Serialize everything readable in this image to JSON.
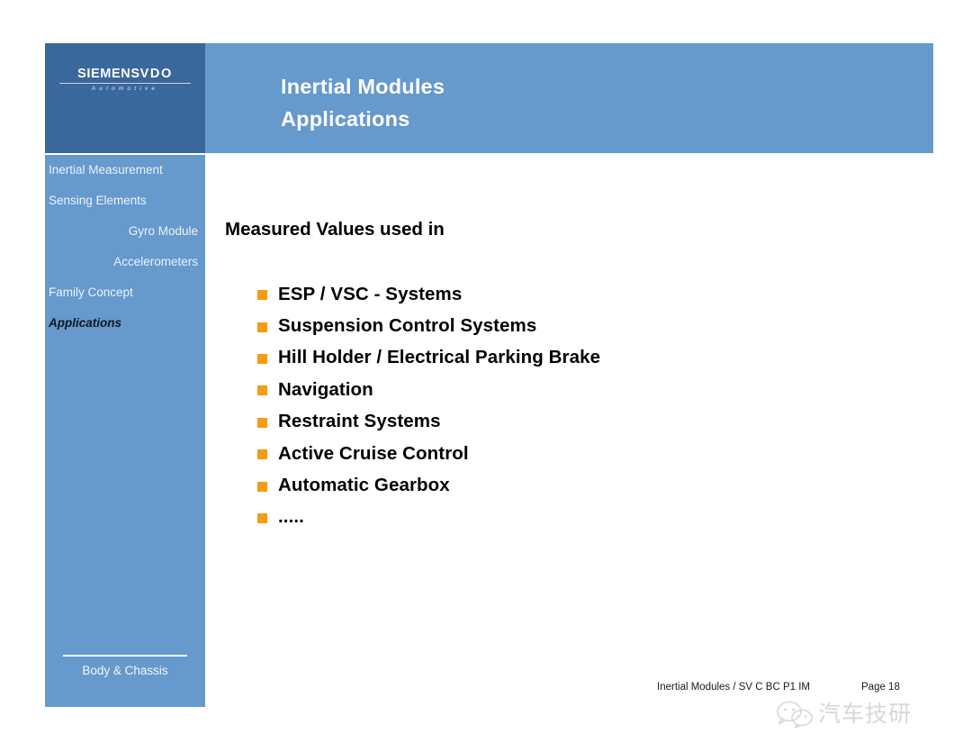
{
  "slide": {
    "title_line1": "Inertial Modules",
    "title_line2": "Applications",
    "heading": "Measured Values used in"
  },
  "logo": {
    "brand": "SIEMENS",
    "brand_suffix": "VDO",
    "tagline": "Automotive"
  },
  "sidebar": {
    "items": [
      {
        "label": "Inertial Measurement",
        "level": 1,
        "active": false
      },
      {
        "label": "Sensing Elements",
        "level": 1,
        "active": false
      },
      {
        "label": "Gyro Module",
        "level": 2,
        "active": false
      },
      {
        "label": "Accelerometers",
        "level": 2,
        "active": false
      },
      {
        "label": "Family Concept",
        "level": 1,
        "active": false
      },
      {
        "label": "Applications",
        "level": 1,
        "active": true
      }
    ],
    "footer_label": "Body & Chassis"
  },
  "bullets": [
    "ESP / VSC - Systems",
    "Suspension Control Systems",
    "Hill Holder / Electrical Parking Brake",
    "Navigation",
    "Restraint Systems",
    "Active Cruise Control",
    "Automatic Gearbox",
    "....."
  ],
  "footer": {
    "reference": "Inertial Modules / SV C BC P1 IM",
    "page": "Page 18"
  },
  "watermark": {
    "text": "汽车技研"
  },
  "colors": {
    "header_dark_blue": "#3a679c",
    "panel_blue": "#6699cc",
    "bullet_orange": "#f59b14",
    "text_white": "#ffffff",
    "text_black": "#000000"
  }
}
